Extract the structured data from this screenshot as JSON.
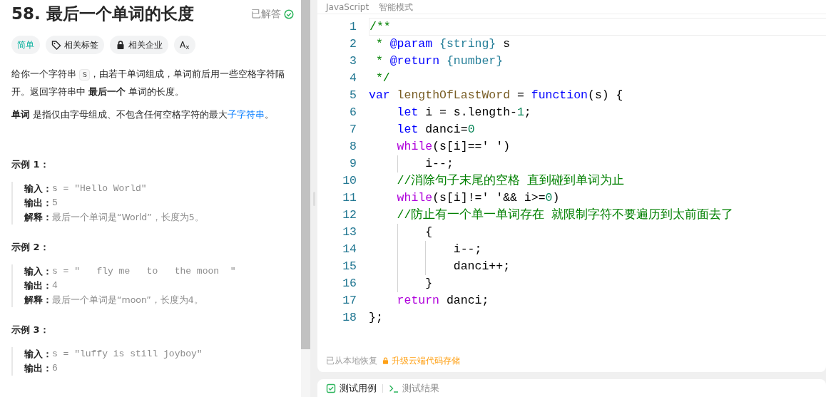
{
  "problem": {
    "title": "58. 最后一个单词的长度",
    "status": "已解答",
    "solved": true,
    "tags": [
      {
        "kind": "difficulty",
        "label": "简单"
      },
      {
        "kind": "tag",
        "label": "相关标签"
      },
      {
        "kind": "lock",
        "label": "相关企业"
      },
      {
        "kind": "translate",
        "label": "A$_{x}$"
      }
    ],
    "description": [
      {
        "parts": [
          {
            "kind": "text",
            "text": "给你一个字符串 "
          },
          {
            "kind": "code",
            "text": "s"
          },
          {
            "kind": "text",
            "text": "，由若干单词组成，单词前后用一些空格字符隔开。返回字符串中 **最后一个** 单词的长度。"
          }
        ]
      },
      {
        "parts": [
          {
            "kind": "text",
            "text": "**单词** 是指仅由字母组成、不包含任何空格字符的最大"
          },
          {
            "kind": "link",
            "text": "子字符串"
          },
          {
            "kind": "text",
            "text": "。"
          }
        ]
      }
    ],
    "examples": [
      {
        "title": "示例 1：",
        "rows": [
          {
            "label": "输入：",
            "value": "s = \"Hello World\""
          },
          {
            "label": "输出：",
            "value": "5"
          },
          {
            "label": "解释：",
            "value": "最后一个单词是“World”，长度为5。"
          }
        ]
      },
      {
        "title": "示例 2：",
        "rows": [
          {
            "label": "输入：",
            "value": "s = \"   fly me   to   the moon  \""
          },
          {
            "label": "输出：",
            "value": "4"
          },
          {
            "label": "解释：",
            "value": "最后一个单词是“moon”，长度为4。"
          }
        ]
      },
      {
        "title": "示例 3：",
        "rows": [
          {
            "label": "输入：",
            "value": "s = \"luffy is still joyboy\""
          },
          {
            "label": "输出：",
            "value": "6"
          }
        ]
      }
    ]
  },
  "editor": {
    "language": "JavaScript",
    "mode": "智能模式",
    "lines": [
      {
        "number": "1",
        "tokens": [
          {
            "kind": "comment",
            "text": "/**"
          }
        ]
      },
      {
        "number": "2",
        "tokens": [
          {
            "kind": "comment",
            "text": " * "
          },
          {
            "kind": "keyword",
            "text": "@param"
          },
          {
            "kind": "type",
            "text": " {string}"
          },
          {
            "kind": "plain",
            "text": " s"
          }
        ]
      },
      {
        "number": "3",
        "tokens": [
          {
            "kind": "comment",
            "text": " * "
          },
          {
            "kind": "keyword",
            "text": "@return"
          },
          {
            "kind": "type",
            "text": " {number}"
          }
        ]
      },
      {
        "number": "4",
        "tokens": [
          {
            "kind": "comment",
            "text": " */"
          }
        ]
      },
      {
        "number": "5",
        "tokens": [
          {
            "kind": "keyword",
            "text": "var"
          },
          {
            "kind": "name",
            "text": " lengthOfLastWord"
          },
          {
            "kind": "plain",
            "text": " = "
          },
          {
            "kind": "keyword",
            "text": "function"
          },
          {
            "kind": "plain",
            "text": "(s) {"
          }
        ]
      },
      {
        "number": "6",
        "tokens": [
          {
            "kind": "keyword",
            "text": "    let"
          },
          {
            "kind": "plain",
            "text": " i = s.length-"
          },
          {
            "kind": "number",
            "text": "1"
          },
          {
            "kind": "plain",
            "text": ";"
          }
        ]
      },
      {
        "number": "7",
        "tokens": [
          {
            "kind": "keyword",
            "text": "    let"
          },
          {
            "kind": "plain",
            "text": " danci="
          },
          {
            "kind": "number",
            "text": "0"
          }
        ]
      },
      {
        "number": "8",
        "tokens": [
          {
            "kind": "control",
            "text": "    while"
          },
          {
            "kind": "plain",
            "text": "(s[i]==' ')"
          }
        ]
      },
      {
        "number": "9",
        "tokens": [
          {
            "kind": "plain",
            "text": "        i--;"
          }
        ]
      },
      {
        "number": "10",
        "tokens": [
          {
            "kind": "comment",
            "text": "    //消除句子末尾的空格 直到碰到单词为止"
          }
        ]
      },
      {
        "number": "11",
        "tokens": [
          {
            "kind": "control",
            "text": "    while"
          },
          {
            "kind": "plain",
            "text": "(s[i]!=' '&& i>="
          },
          {
            "kind": "number",
            "text": "0"
          },
          {
            "kind": "plain",
            "text": ")"
          }
        ]
      },
      {
        "number": "12",
        "tokens": [
          {
            "kind": "comment",
            "text": "    //防止有一个单一单词存在 就限制字符不要遍历到太前面去了"
          }
        ]
      },
      {
        "number": "13",
        "tokens": [
          {
            "kind": "plain",
            "text": "        {"
          }
        ]
      },
      {
        "number": "14",
        "tokens": [
          {
            "kind": "plain",
            "text": "            i--;"
          }
        ]
      },
      {
        "number": "15",
        "tokens": [
          {
            "kind": "plain",
            "text": "            danci++;"
          }
        ]
      },
      {
        "number": "16",
        "tokens": [
          {
            "kind": "plain",
            "text": "        }"
          }
        ]
      },
      {
        "number": "17",
        "tokens": [
          {
            "kind": "control",
            "text": "    return"
          },
          {
            "kind": "plain",
            "text": " danci;"
          }
        ]
      },
      {
        "number": "18",
        "tokens": [
          {
            "kind": "plain",
            "text": "};"
          }
        ]
      }
    ],
    "restore_note": "已从本地恢复",
    "upgrade_link": "升级云端代码存储"
  },
  "bottom_tabs": [
    {
      "kind": "check",
      "label": "测试用例",
      "selected": true
    },
    {
      "kind": "terminal",
      "label": "测试结果",
      "selected": false
    }
  ]
}
